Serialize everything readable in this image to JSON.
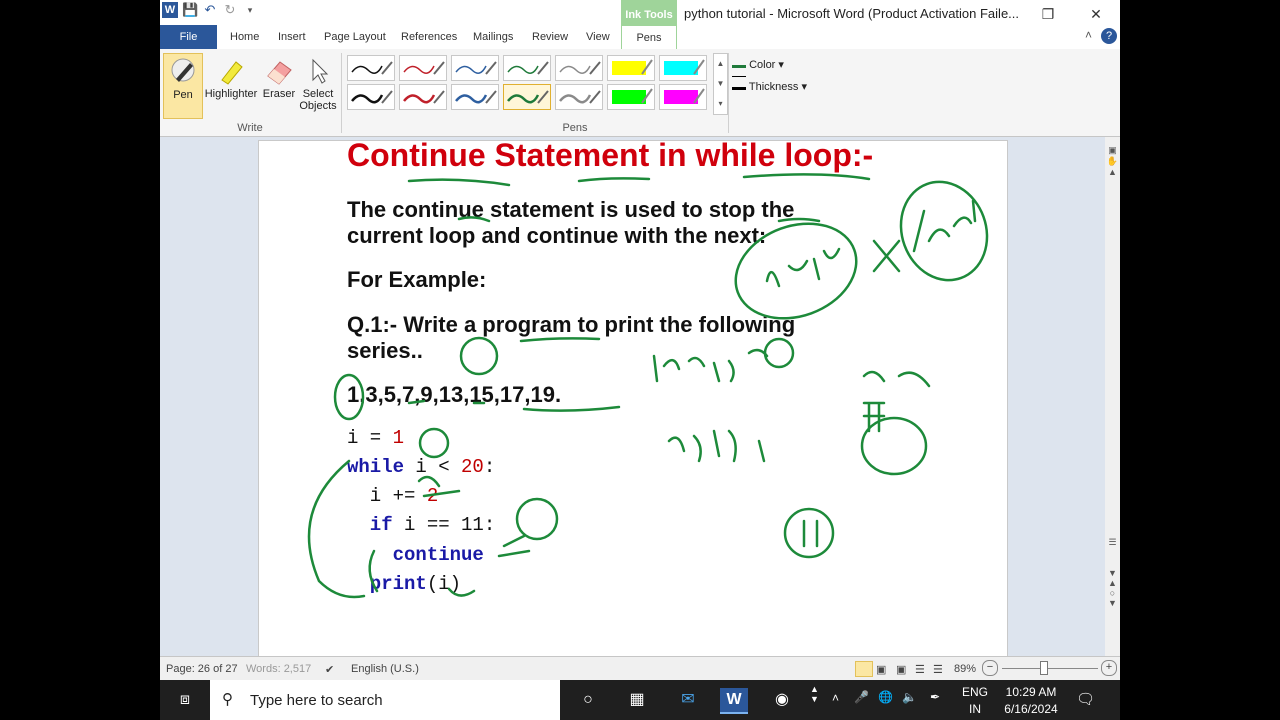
{
  "window": {
    "title": "python tutorial  -  Microsoft Word (Product Activation Faile...",
    "contextual_tab": "Ink Tools"
  },
  "tabs": [
    "File",
    "Home",
    "Insert",
    "Page Layout",
    "References",
    "Mailings",
    "Review",
    "View",
    "Pens"
  ],
  "ribbon": {
    "write_group": "Write",
    "pens_group": "Pens",
    "pen_label": "Pen",
    "highlighter_label": "Highlighter",
    "eraser_label": "Eraser",
    "select_label_1": "Select",
    "select_label_2": "Objects",
    "color_label": "Color",
    "thickness_label": "Thickness",
    "pen_colors_row1": [
      "#111111",
      "#c0202a",
      "#2e5fa0",
      "#1f7a3a",
      "#8a8a8a",
      "#ffff00",
      "#00ffff"
    ],
    "pen_colors_row2": [
      "#111111",
      "#c0202a",
      "#2e5fa0",
      "#1f7a3a",
      "#8a8a8a",
      "#00ff00",
      "#ff00ff"
    ]
  },
  "document": {
    "heading": "Continue Statement in while loop:-",
    "line1": "The continue statement is used to stop the",
    "line2": "current loop and continue with the next:",
    "example": "For Example:",
    "q1_line1": "Q.1:- Write a program to print the following",
    "q1_line2": "series..",
    "series": "1,3,5,7,9,13,15,17,19.",
    "code": {
      "l1_a": "i = ",
      "l1_b": "1",
      "l2_kw": "while",
      "l2_a": " i < ",
      "l2_b": "20",
      "l2_c": ":",
      "l3_a": "  i += ",
      "l3_b": "2",
      "l4_kw": "  if",
      "l4_a": " i == 11:",
      "l5_kw": "    continue",
      "l6_kw": "  print",
      "l6_a": "(i)"
    }
  },
  "status": {
    "page": "Page: 26 of 27",
    "words": "Words: 2,517",
    "language": "English (U.S.)",
    "zoom": "89%"
  },
  "taskbar": {
    "search_placeholder": "Type here to search",
    "lang1": "ENG",
    "lang2": "IN",
    "time": "10:29 AM",
    "date": "6/16/2024"
  }
}
